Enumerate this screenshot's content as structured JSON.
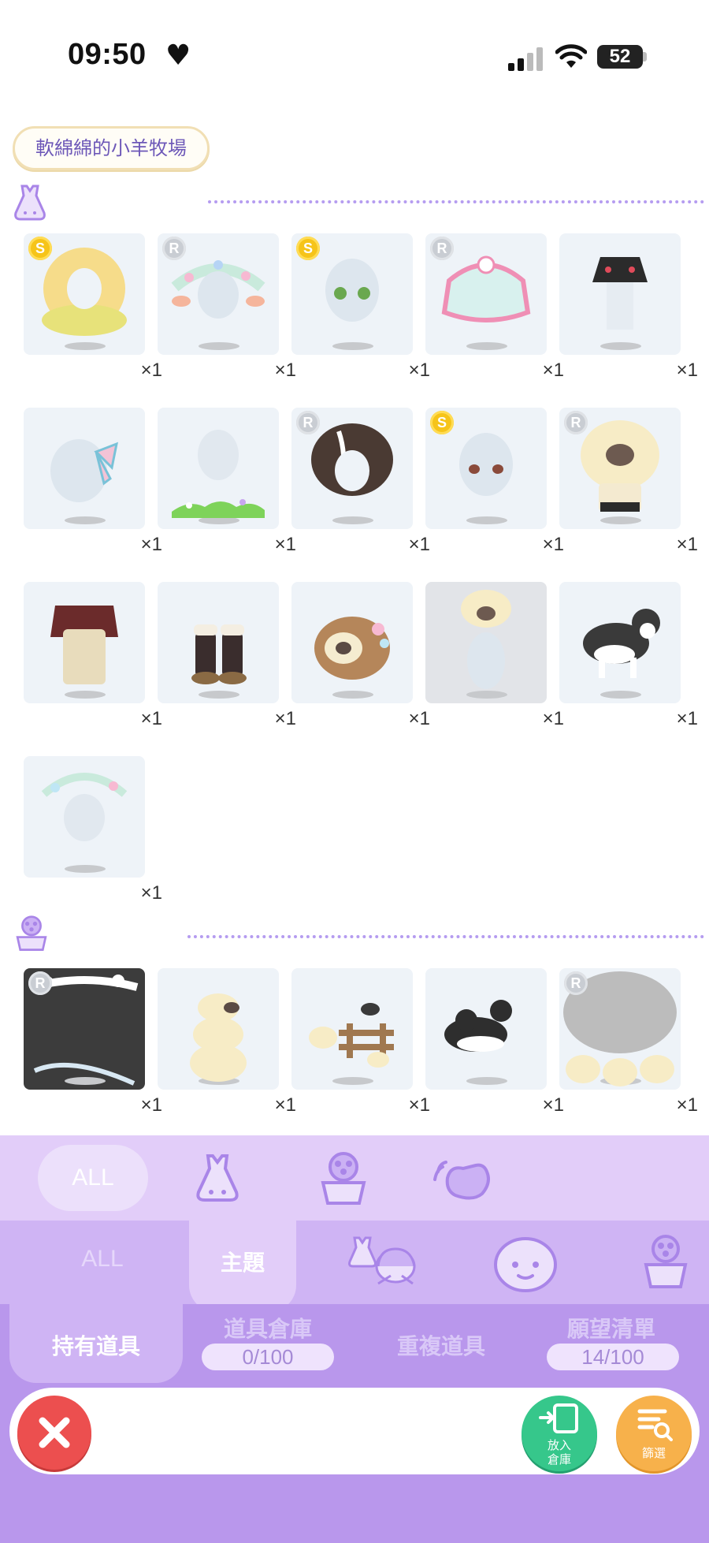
{
  "status": {
    "time": "09:50",
    "battery": "52"
  },
  "theme_tag": "軟綿綿的小羊牧場",
  "outfit_section": {
    "items": [
      {
        "name": "yellow-curly-hair",
        "badge": "S",
        "qty": "×1"
      },
      {
        "name": "flower-wreath-sheep-ears",
        "badge": "R",
        "qty": "×1"
      },
      {
        "name": "green-eyes",
        "badge": "S",
        "qty": "×1"
      },
      {
        "name": "pink-teal-skirt",
        "badge": "R",
        "qty": "×1"
      },
      {
        "name": "black-embroidered-vest",
        "badge": "",
        "qty": "×1"
      },
      {
        "name": "ribbon-bow",
        "badge": "",
        "qty": "×1"
      },
      {
        "name": "grass-flowers",
        "badge": "",
        "qty": "×1"
      },
      {
        "name": "brown-messy-hair",
        "badge": "R",
        "qty": "×1"
      },
      {
        "name": "brown-eyes",
        "badge": "S",
        "qty": "×1"
      },
      {
        "name": "sheep-costume",
        "badge": "R",
        "qty": "×1"
      },
      {
        "name": "plaid-overalls",
        "badge": "",
        "qty": "×1"
      },
      {
        "name": "fur-boots",
        "badge": "",
        "qty": "×1"
      },
      {
        "name": "flower-basket-sheep",
        "badge": "",
        "qty": "×1"
      },
      {
        "name": "sheep-hat",
        "badge": "",
        "qty": "×1"
      },
      {
        "name": "border-collie",
        "badge": "",
        "qty": "×1"
      },
      {
        "name": "flower-garland-headband",
        "badge": "",
        "qty": "×1"
      }
    ]
  },
  "deco_section": {
    "items": [
      {
        "name": "chalkboard-flower-frame",
        "badge": "R",
        "qty": "×1"
      },
      {
        "name": "stacked-sheep",
        "badge": "",
        "qty": "×1"
      },
      {
        "name": "sheep-fence",
        "badge": "",
        "qty": "×1"
      },
      {
        "name": "two-collies",
        "badge": "",
        "qty": "×1"
      },
      {
        "name": "sheep-oval-frame",
        "badge": "R",
        "qty": "×1"
      }
    ]
  },
  "bottom": {
    "cat_all": "ALL",
    "sub_all": "ALL",
    "sub_theme": "主題",
    "tab_owned": "持有道具",
    "tab_storage": "道具倉庫",
    "storage_count": "0/100",
    "tab_duplicate": "重複道具",
    "tab_wishlist": "願望清單",
    "wishlist_count": "14/100",
    "store_label_1": "放入",
    "store_label_2": "倉庫",
    "filter_label": "篩選"
  },
  "colors": {
    "accent": "#b997ec",
    "close": "#ec4f4f",
    "store": "#36c78b",
    "filter": "#f7b14b"
  }
}
